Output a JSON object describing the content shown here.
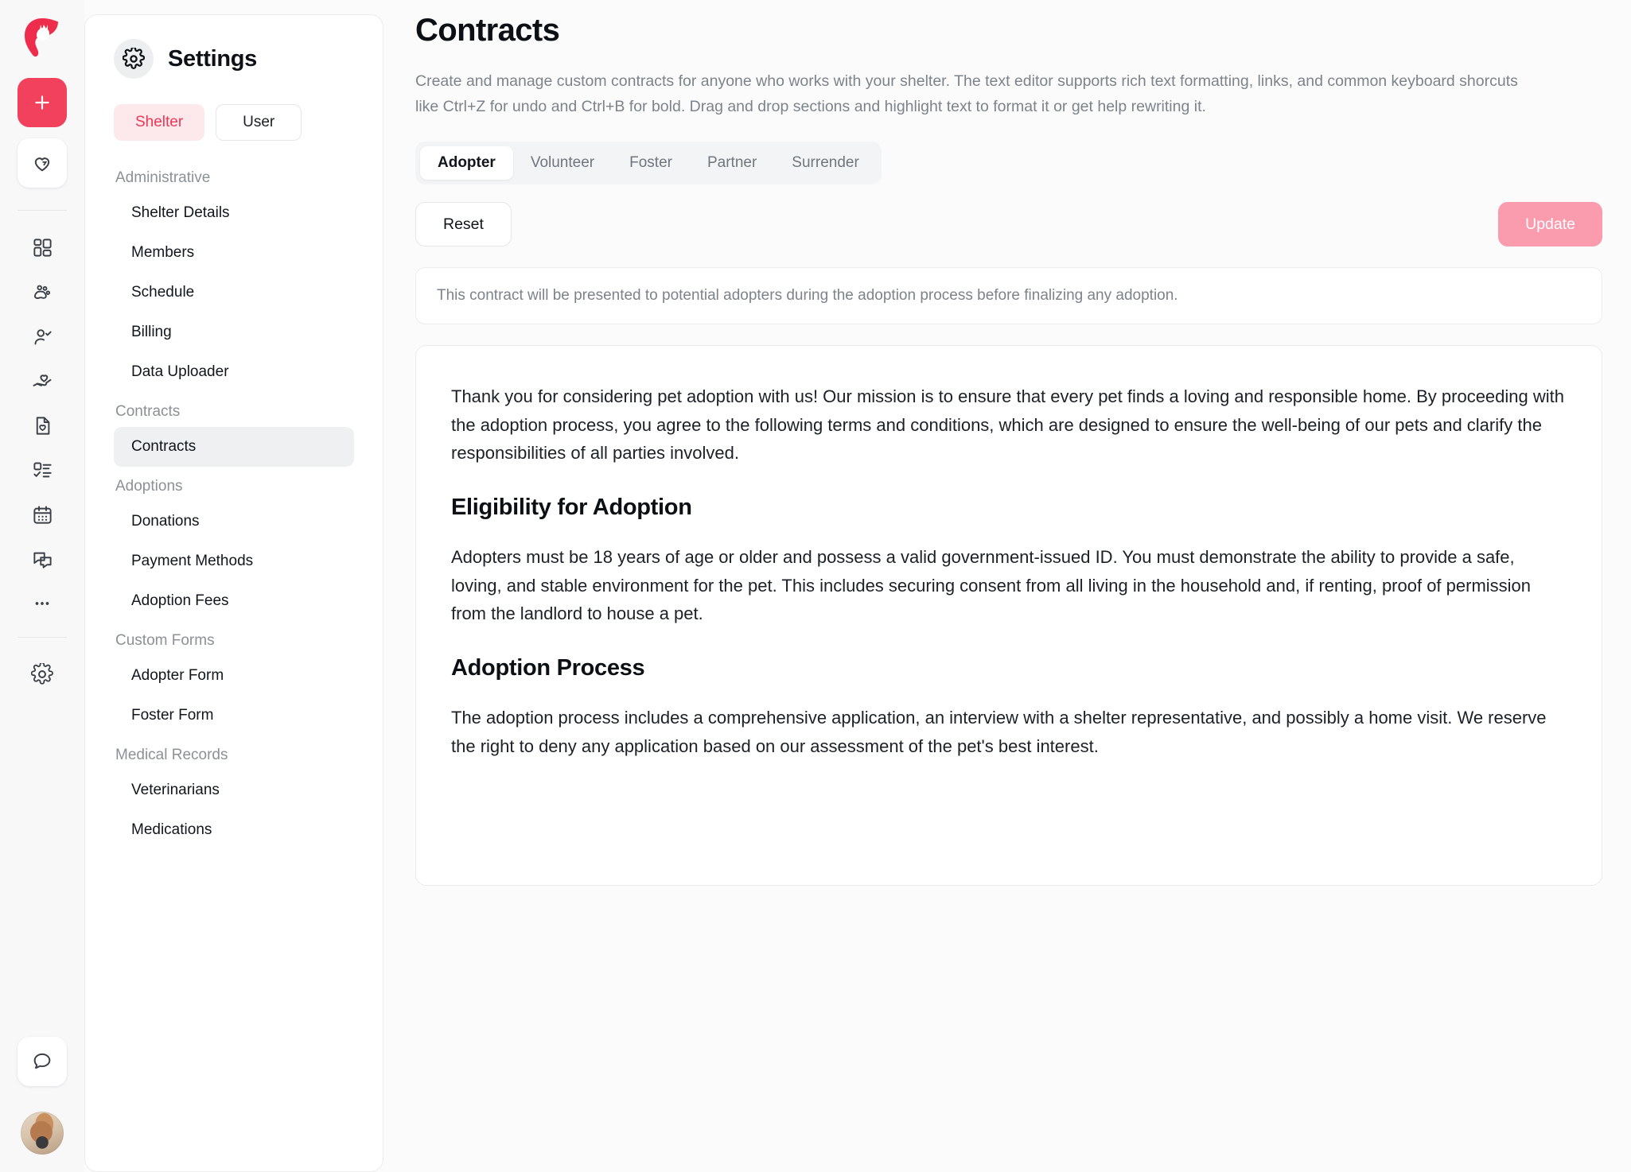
{
  "brand": {
    "logo_icon": "pet-logo-icon",
    "accent": "#f2415c",
    "accent_soft": "#fa9cad",
    "accent_tint": "#fde8ec"
  },
  "rail": {
    "add_icon": "plus-icon",
    "favorites_icon": "heart-hands-icon",
    "items": [
      {
        "icon": "dashboard-grid-icon"
      },
      {
        "icon": "paw-icon"
      },
      {
        "icon": "user-check-icon"
      },
      {
        "icon": "hand-heart-icon"
      },
      {
        "icon": "file-heart-icon"
      },
      {
        "icon": "checklist-icon"
      },
      {
        "icon": "calendar-icon"
      },
      {
        "icon": "chat-messages-icon"
      },
      {
        "icon": "more-dots-icon"
      }
    ],
    "settings_icon": "gear-icon",
    "support_icon": "chat-bubble-icon",
    "avatar_icon": "user-avatar"
  },
  "settings": {
    "gear_icon": "gear-icon",
    "title": "Settings",
    "scope_tabs": [
      {
        "label": "Shelter",
        "active": true
      },
      {
        "label": "User",
        "active": false
      }
    ],
    "groups": [
      {
        "label": "Administrative",
        "items": [
          {
            "label": "Shelter Details",
            "active": false
          },
          {
            "label": "Members",
            "active": false
          },
          {
            "label": "Schedule",
            "active": false
          },
          {
            "label": "Billing",
            "active": false
          },
          {
            "label": "Data Uploader",
            "active": false
          }
        ]
      },
      {
        "label": "Contracts",
        "items": [
          {
            "label": "Contracts",
            "active": true
          }
        ]
      },
      {
        "label": "Adoptions",
        "items": [
          {
            "label": "Donations",
            "active": false
          },
          {
            "label": "Payment Methods",
            "active": false
          },
          {
            "label": "Adoption Fees",
            "active": false
          }
        ]
      },
      {
        "label": "Custom Forms",
        "items": [
          {
            "label": "Adopter Form",
            "active": false
          },
          {
            "label": "Foster Form",
            "active": false
          }
        ]
      },
      {
        "label": "Medical Records",
        "items": [
          {
            "label": "Veterinarians",
            "active": false
          },
          {
            "label": "Medications",
            "active": false
          }
        ]
      }
    ]
  },
  "main": {
    "title": "Contracts",
    "description": "Create and manage custom contracts for anyone who works with your shelter. The text editor supports rich text formatting, links, and common keyboard shorcuts like Ctrl+Z for undo and Ctrl+B for bold. Drag and drop sections and highlight text to format it or get help rewriting it.",
    "tabs": [
      {
        "label": "Adopter",
        "active": true
      },
      {
        "label": "Volunteer",
        "active": false
      },
      {
        "label": "Foster",
        "active": false
      },
      {
        "label": "Partner",
        "active": false
      },
      {
        "label": "Surrender",
        "active": false
      }
    ],
    "reset_label": "Reset",
    "update_label": "Update",
    "notice": "This contract will be presented to potential adopters during the adoption process before finalizing any adoption.",
    "contract": {
      "intro": "Thank you for considering pet adoption with us! Our mission is to ensure that every pet finds a loving and responsible home. By proceeding with the adoption process, you agree to the following terms and conditions, which are designed to ensure the well-being of our pets and clarify the responsibilities of all parties involved.",
      "eligibility_heading": "Eligibility for Adoption",
      "eligibility_body": "Adopters must be 18 years of age or older and possess a valid government-issued ID. You must demonstrate the ability to provide a safe, loving, and stable environment for the pet. This includes securing consent from all living in the household and, if renting, proof of permission from the landlord to house a pet.",
      "process_heading": "Adoption Process",
      "process_body": "The adoption process includes a comprehensive application, an interview with a shelter representative, and possibly a home visit. We reserve the right to deny any application based on our assessment of the pet's best interest."
    }
  }
}
